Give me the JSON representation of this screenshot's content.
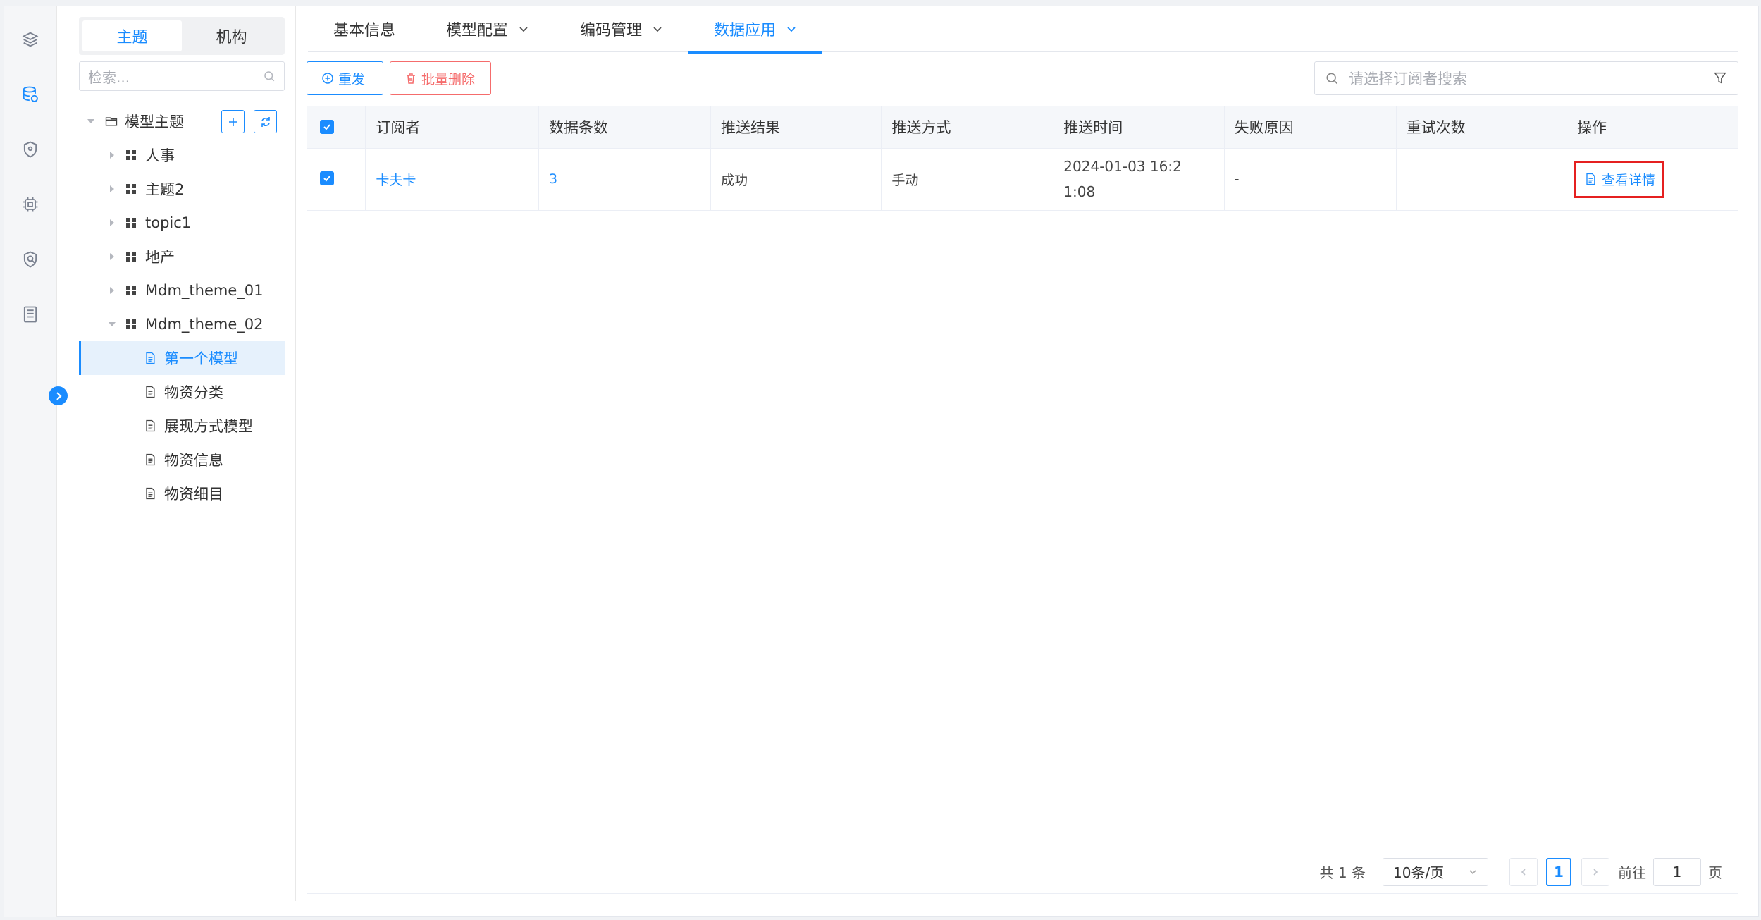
{
  "segment": {
    "tabs": [
      "主题",
      "机构"
    ],
    "active": 0
  },
  "tree_search": {
    "placeholder": "检索..."
  },
  "tree": {
    "root": "模型主题",
    "nodes": [
      {
        "label": "人事"
      },
      {
        "label": "主题2"
      },
      {
        "label": "topic1"
      },
      {
        "label": "地产"
      },
      {
        "label": "Mdm_theme_01"
      },
      {
        "label": "Mdm_theme_02"
      }
    ],
    "children": [
      {
        "label": "第一个模型"
      },
      {
        "label": "物资分类"
      },
      {
        "label": "展现方式模型"
      },
      {
        "label": "物资信息"
      },
      {
        "label": "物资细目"
      }
    ]
  },
  "tabs": [
    {
      "label": "基本信息"
    },
    {
      "label": "模型配置"
    },
    {
      "label": "编码管理"
    },
    {
      "label": "数据应用"
    }
  ],
  "toolbar": {
    "resend": "重发",
    "batch_delete": "批量删除"
  },
  "search": {
    "placeholder": "请选择订阅者搜索"
  },
  "table": {
    "headers": [
      "订阅者",
      "数据条数",
      "推送结果",
      "推送方式",
      "推送时间",
      "失败原因",
      "重试次数",
      "操作"
    ],
    "rows": [
      {
        "subscriber": "卡夫卡",
        "count": "3",
        "result": "成功",
        "method": "手动",
        "time": "2024-01-03 16:21:08",
        "reason": "-",
        "retries": "",
        "action": "查看详情"
      }
    ]
  },
  "pager": {
    "total": "共 1 条",
    "page_size": "10条/页",
    "current": "1",
    "goto_label": "前往",
    "goto_value": "1",
    "page_suffix": "页"
  },
  "colors": {
    "accent": "#1a8cff",
    "danger": "#f56c6c",
    "highlight_box": "#e52020"
  }
}
